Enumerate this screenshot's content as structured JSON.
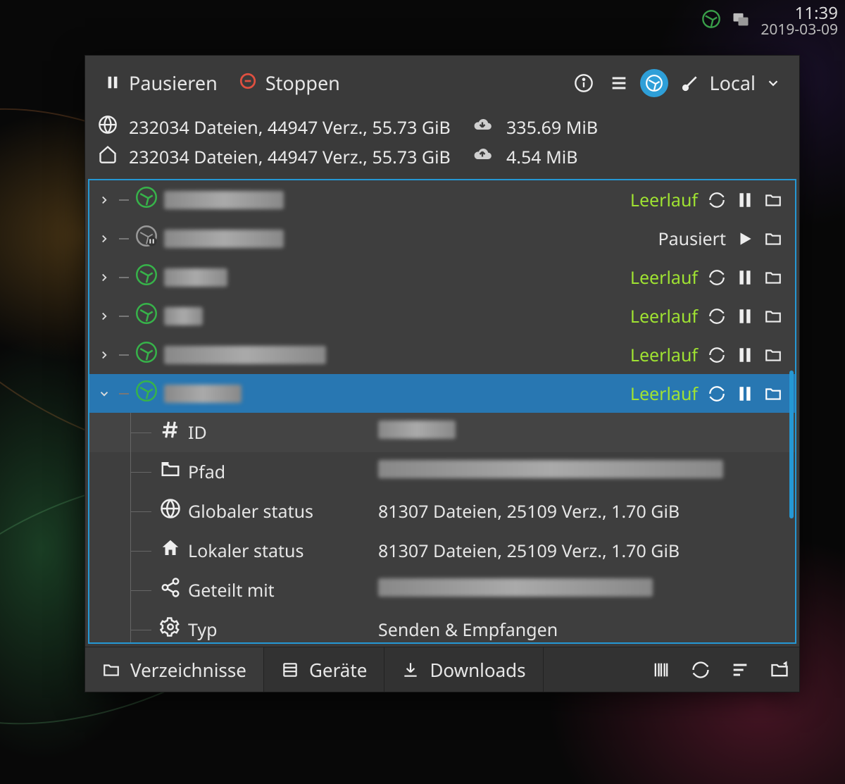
{
  "tray": {
    "time": "11:39",
    "date": "2019-03-09"
  },
  "toolbar": {
    "pause_label": "Pausieren",
    "stop_label": "Stoppen",
    "device_label": "Local"
  },
  "stats": {
    "global": "232034 Dateien, 44947 Verz., 55.73 GiB",
    "local": "232034 Dateien, 44947 Verz., 55.73 GiB",
    "downloaded": "335.69 MiB",
    "uploaded": "4.54 MiB"
  },
  "folders": [
    {
      "status": "Leerlauf",
      "state": "idle",
      "expanded": false,
      "label_width": 170
    },
    {
      "status": "Pausiert",
      "state": "paused",
      "expanded": false,
      "label_width": 170
    },
    {
      "status": "Leerlauf",
      "state": "idle",
      "expanded": false,
      "label_width": 90
    },
    {
      "status": "Leerlauf",
      "state": "idle",
      "expanded": false,
      "label_width": 55
    },
    {
      "status": "Leerlauf",
      "state": "idle",
      "expanded": false,
      "label_width": 230
    },
    {
      "status": "Leerlauf",
      "state": "idle",
      "expanded": true,
      "label_width": 110,
      "selected": true
    }
  ],
  "details": {
    "id_label": "ID",
    "id_value_blur_width": 110,
    "path_label": "Pfad",
    "path_value_blur_width": 490,
    "global_label": "Globaler status",
    "global_value": "81307 Dateien, 25109 Verz., 1.70 GiB",
    "local_label": "Lokaler status",
    "local_value": "81307 Dateien, 25109 Verz., 1.70 GiB",
    "shared_label": "Geteilt mit",
    "shared_value_blur_width": 390,
    "type_label": "Typ",
    "type_value": "Senden & Empfangen"
  },
  "tabs": {
    "folders": "Verzeichnisse",
    "devices": "Geräte",
    "downloads": "Downloads"
  }
}
